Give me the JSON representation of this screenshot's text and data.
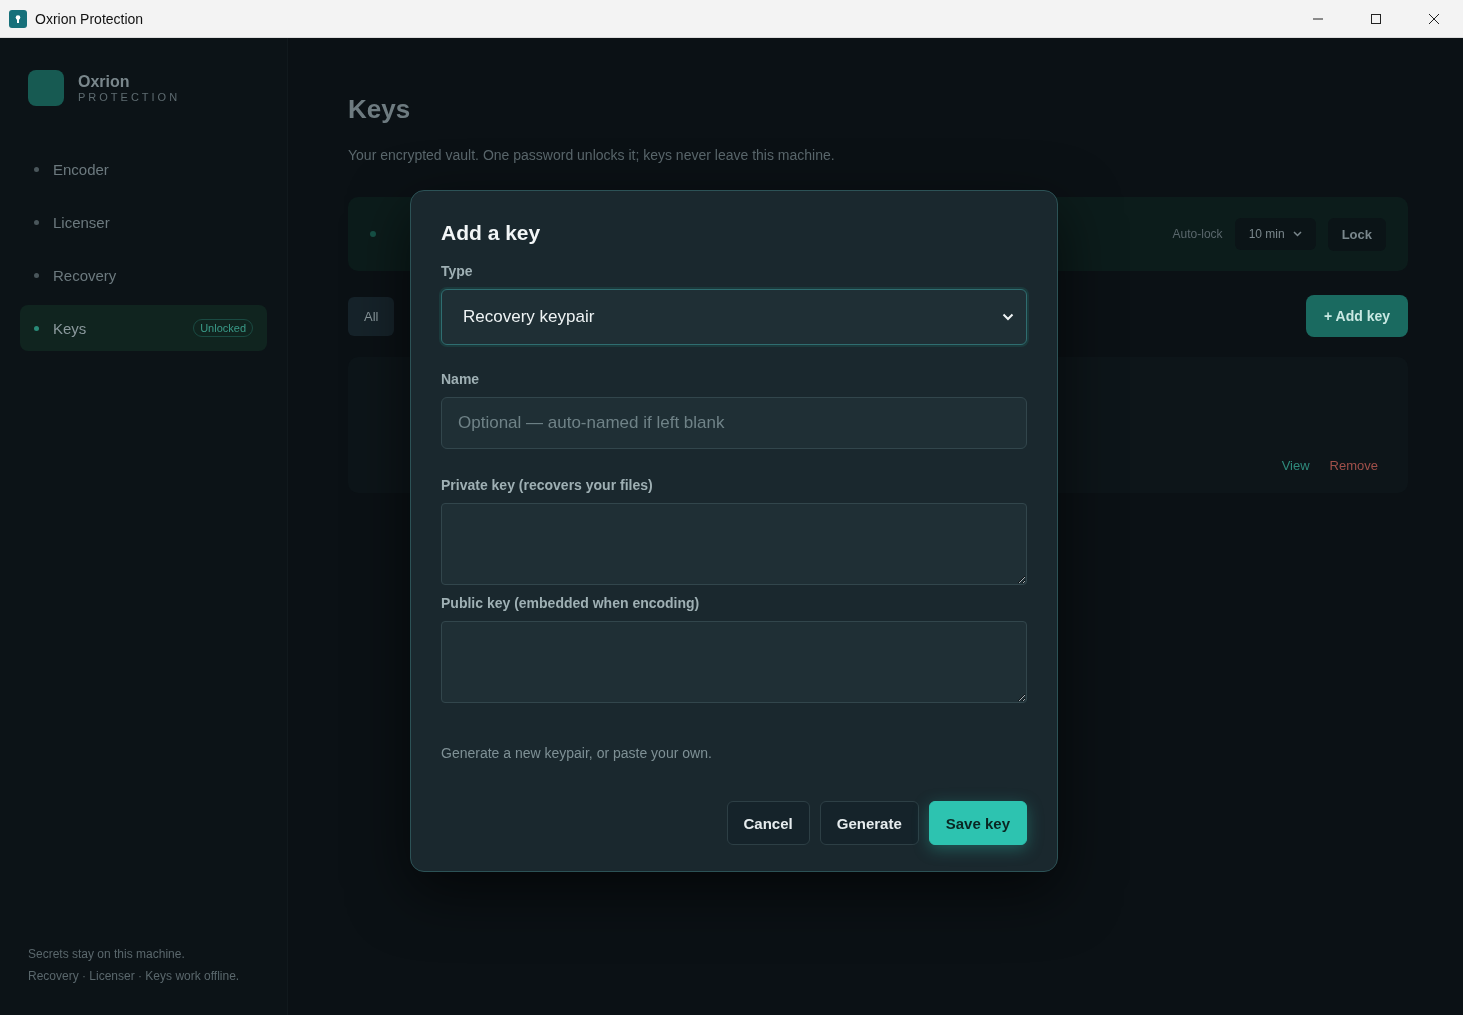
{
  "window": {
    "title": "Oxrion Protection"
  },
  "sidebar": {
    "brand": "Oxrion",
    "tagline": "PROTECTION",
    "items": [
      {
        "label": "Encoder",
        "selected": false
      },
      {
        "label": "Licenser",
        "selected": false
      },
      {
        "label": "Recovery",
        "selected": false
      },
      {
        "label": "Keys",
        "selected": true,
        "badge": "Unlocked"
      }
    ],
    "footer": [
      "Secrets stay on this machine.",
      "Recovery · Licenser · Keys work offline."
    ]
  },
  "page": {
    "title": "Keys",
    "subtitle": "Your encrypted vault. One password unlocks it; keys never leave this machine.",
    "auto_lock_label": "Auto-lock",
    "auto_lock_value": "10 min",
    "lock_button": "Lock",
    "filters": [
      {
        "label": "All",
        "selected": true
      }
    ],
    "add_button": "+ Add key",
    "row_actions": [
      "View",
      "Remove"
    ]
  },
  "dialog": {
    "title": "Add a key",
    "type": {
      "label": "Type",
      "value": "Recovery keypair"
    },
    "name": {
      "label": "Name",
      "placeholder": "Optional — auto-named if left blank"
    },
    "private_key": {
      "label": "Private key (recovers your files)"
    },
    "public_key": {
      "label": "Public key (embedded when encoding)"
    },
    "hint": "Generate a new keypair, or paste your own.",
    "buttons": [
      {
        "label": "Cancel",
        "kind": "secondary"
      },
      {
        "label": "Generate",
        "kind": "secondary"
      },
      {
        "label": "Save key",
        "kind": "primary"
      }
    ]
  }
}
